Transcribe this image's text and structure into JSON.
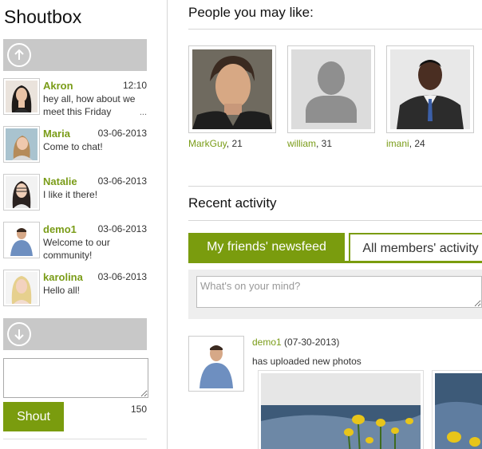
{
  "shoutbox": {
    "title": "Shoutbox",
    "messages": [
      {
        "name": "Akron",
        "time": "12:10",
        "text": "hey all, how about we meet this Friday",
        "more": "..."
      },
      {
        "name": "Maria",
        "time": "03-06-2013",
        "text": "Come to chat!"
      },
      {
        "name": "Natalie",
        "time": "03-06-2013",
        "text": "I like it there!"
      },
      {
        "name": "demo1",
        "time": "03-06-2013",
        "text": "Welcome to our community!"
      },
      {
        "name": "karolina",
        "time": "03-06-2013",
        "text": "Hello all!"
      }
    ],
    "shout_label": "Shout",
    "char_count": "150"
  },
  "people": {
    "title": "People you may like:",
    "items": [
      {
        "name": "MarkGuy",
        "age": ", 21"
      },
      {
        "name": "william",
        "age": ", 31"
      },
      {
        "name": "imani",
        "age": ", 24"
      }
    ]
  },
  "activity": {
    "title": "Recent activity",
    "tabs": [
      {
        "label": "My friends' newsfeed"
      },
      {
        "label": "All members' activity"
      }
    ],
    "mind_placeholder": "What's on your mind?",
    "post": {
      "user": "demo1",
      "date": " (07-30-2013)",
      "text": "has uploaded new photos"
    }
  },
  "colors": {
    "accent": "#7a9c0e",
    "name_link": "#7a9c18",
    "nav_bar": "#c8c8c8"
  },
  "icons": [
    "arrow-up-icon",
    "arrow-down-icon",
    "default-avatar-icon"
  ]
}
